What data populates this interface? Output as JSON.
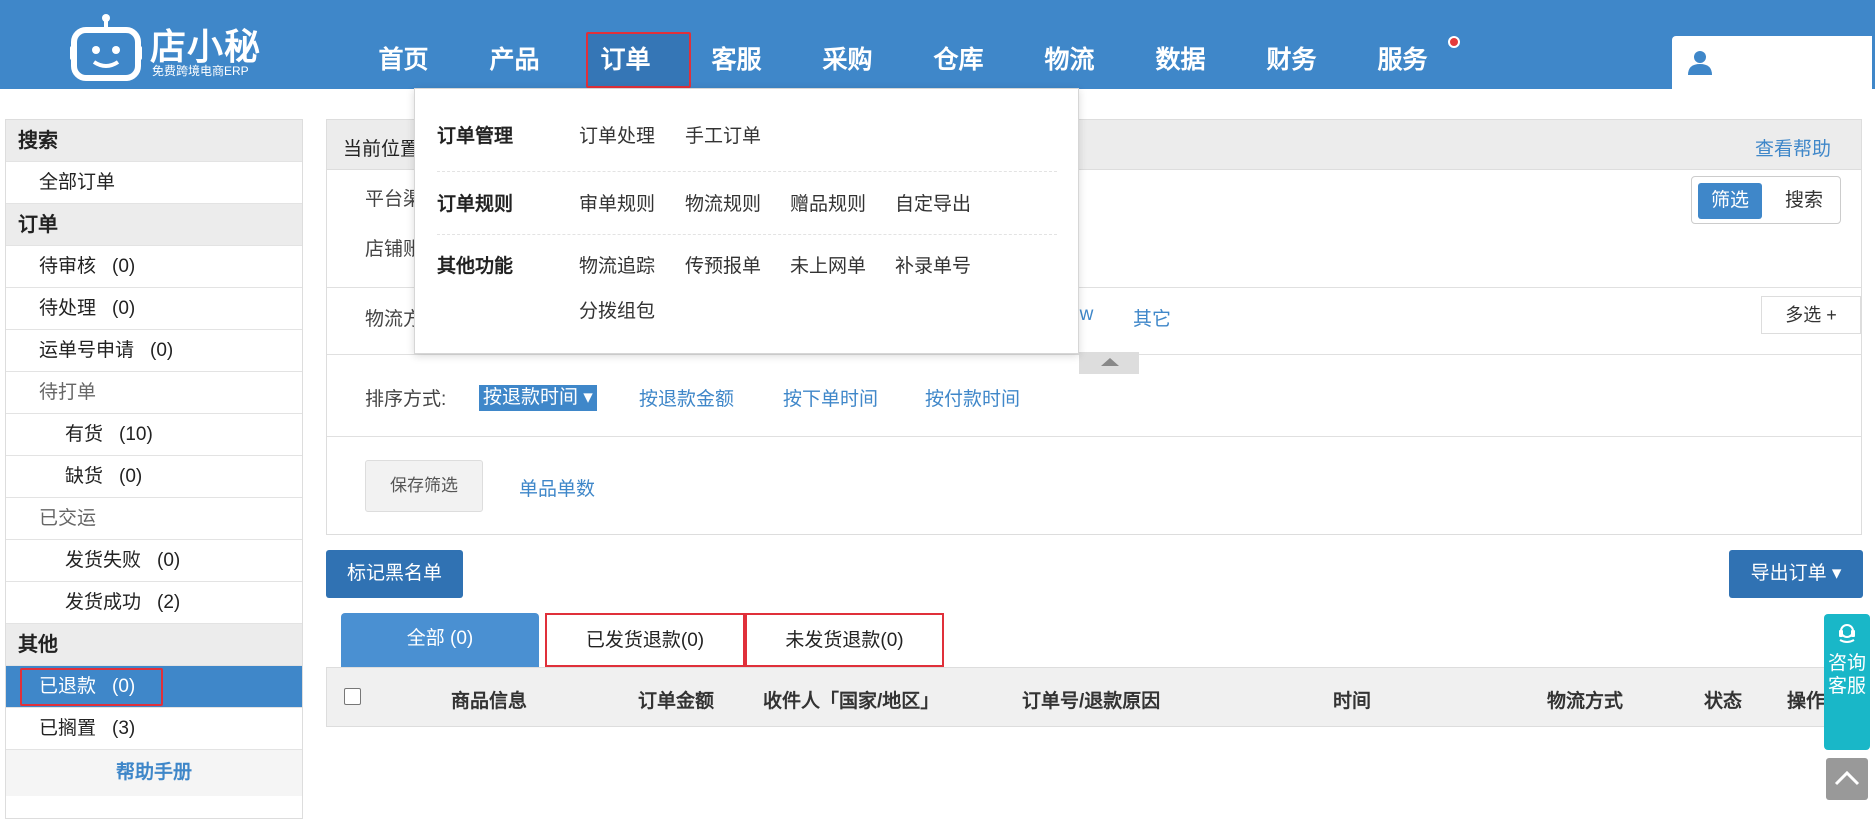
{
  "brand": {
    "name": "店小秘",
    "tagline": "免费跨境电商ERP"
  },
  "nav": {
    "items": [
      "首页",
      "产品",
      "订单",
      "客服",
      "采购",
      "仓库",
      "物流",
      "数据",
      "财务",
      "服务"
    ],
    "active": "订单"
  },
  "sidebar": {
    "search_head": "搜索",
    "all_orders": "全部订单",
    "order_head": "订单",
    "pending_review": {
      "label": "待审核",
      "count": "(0)"
    },
    "pending_process": {
      "label": "待处理",
      "count": "(0)"
    },
    "tracking_request": {
      "label": "运单号申请",
      "count": "(0)"
    },
    "to_print": "待打单",
    "in_stock": {
      "label": "有货",
      "count": "(10)"
    },
    "out_of_stock": {
      "label": "缺货",
      "count": "(0)"
    },
    "shipped": "已交运",
    "ship_failed": {
      "label": "发货失败",
      "count": "(0)"
    },
    "ship_success": {
      "label": "发货成功",
      "count": "(2)"
    },
    "other_head": "其他",
    "refunded": {
      "label": "已退款",
      "count": "(0)"
    },
    "on_hold": {
      "label": "已搁置",
      "count": "(3)"
    },
    "help": "帮助手册"
  },
  "main": {
    "crumb": "当前位置",
    "help_link": "查看帮助",
    "platform_label": "平台渠",
    "shop_label": "店铺账",
    "logistics_label": "物流方",
    "filter_toggle": {
      "on": "筛选",
      "off": "搜索"
    },
    "logistics_tail": [
      "qw",
      "其它"
    ],
    "multi_select": "多选 +",
    "sort_label": "排序方式:",
    "sort_selected": "按退款时间",
    "sort_options": [
      "按退款金额",
      "按下单时间",
      "按付款时间"
    ],
    "save_filter": "保存筛选",
    "single_sku": "单品单数"
  },
  "actions": {
    "blacklist": "标记黑名单",
    "export": "导出订单"
  },
  "tabs": [
    {
      "label": "全部 (0)"
    },
    {
      "label": "已发货退款(0)"
    },
    {
      "label": "未发货退款(0)"
    }
  ],
  "table_headers": [
    "商品信息",
    "订单金额",
    "收件人「国家/地区」",
    "订单号/退款原因",
    "时间",
    "物流方式",
    "状态",
    "操作"
  ],
  "dropdown": {
    "order_mgmt": {
      "title": "订单管理",
      "links": [
        "订单处理",
        "手工订单"
      ]
    },
    "order_rules": {
      "title": "订单规则",
      "links": [
        "审单规则",
        "物流规则",
        "赠品规则",
        "自定导出"
      ]
    },
    "other_funcs": {
      "title": "其他功能",
      "links": [
        "物流追踪",
        "传预报单",
        "未上网单",
        "补录单号",
        "分拨组包"
      ]
    }
  },
  "consult": "咨询客服",
  "colors": {
    "brand_blue": "#3f87c9",
    "highlight_red": "#e0303a",
    "consult_teal": "#19b7c8"
  }
}
